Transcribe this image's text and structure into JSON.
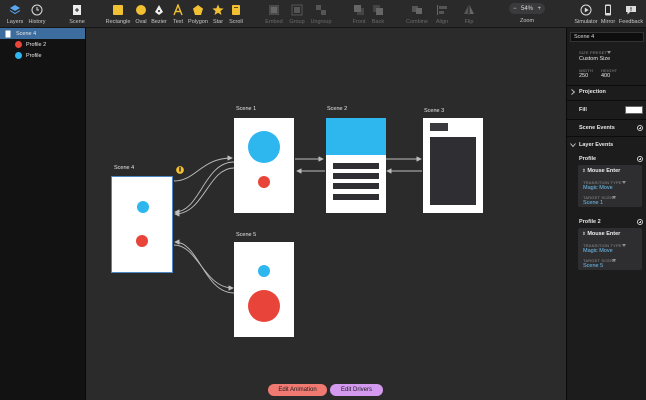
{
  "toolbar": {
    "layers": "Layers",
    "history": "History",
    "scene": "Scene",
    "rectangle": "Rectangle",
    "oval": "Oval",
    "bezier": "Bezier",
    "text": "Text",
    "polygon": "Polygon",
    "star": "Star",
    "scroll": "Scroll",
    "embed": "Embed",
    "group": "Group",
    "ungroup": "Ungroup",
    "front": "Front",
    "back": "Back",
    "combine": "Combine",
    "align": "Align",
    "flip": "Flip",
    "zoom_minus": "−",
    "zoom_value": "54%",
    "zoom_plus": "+",
    "zoom": "Zoom",
    "simulator": "Simulator",
    "mirror": "Mirror",
    "feedback": "Feedback"
  },
  "layers": [
    {
      "name": "Scene 4",
      "selected": true
    },
    {
      "name": "Profile 2",
      "color": "#e9443a"
    },
    {
      "name": "Profile",
      "color": "#2eb7ef"
    }
  ],
  "canvas": {
    "scenes": [
      "Scene 1",
      "Scene 2",
      "Scene 3",
      "Scene 4",
      "Scene 5"
    ],
    "edit_animation": "Edit Animation",
    "edit_drivers": "Edit Drivers"
  },
  "inspector": {
    "scene_name": "Scene 4",
    "size_preset_label": "SIZE PRESET",
    "size_preset_value": "Custom Size",
    "width_label": "WIDTH",
    "width_value": "250",
    "height_label": "HEIGHT",
    "height_value": "400",
    "projection": "Projection",
    "fill": "Fill",
    "scene_events": "Scene Events",
    "layer_events": "Layer Events",
    "events": [
      {
        "layer": "Profile",
        "trigger": "Mouse Enter",
        "transition_label": "TRANSITION TYPE",
        "transition": "Magic Move",
        "target_label": "TARGET SCENE",
        "target": "Scene 1"
      },
      {
        "layer": "Profile 2",
        "trigger": "Mouse Enter",
        "transition_label": "TRANSITION TYPE",
        "transition": "Magic Move",
        "target_label": "TARGET SCENE",
        "target": "Scene 5"
      }
    ]
  },
  "colors": {
    "accent_blue": "#2eb7ef",
    "accent_red": "#e9443a",
    "selection": "#3d6d9e",
    "edit_animation_btn": "#f07a72",
    "edit_drivers_btn": "#d49af0"
  }
}
